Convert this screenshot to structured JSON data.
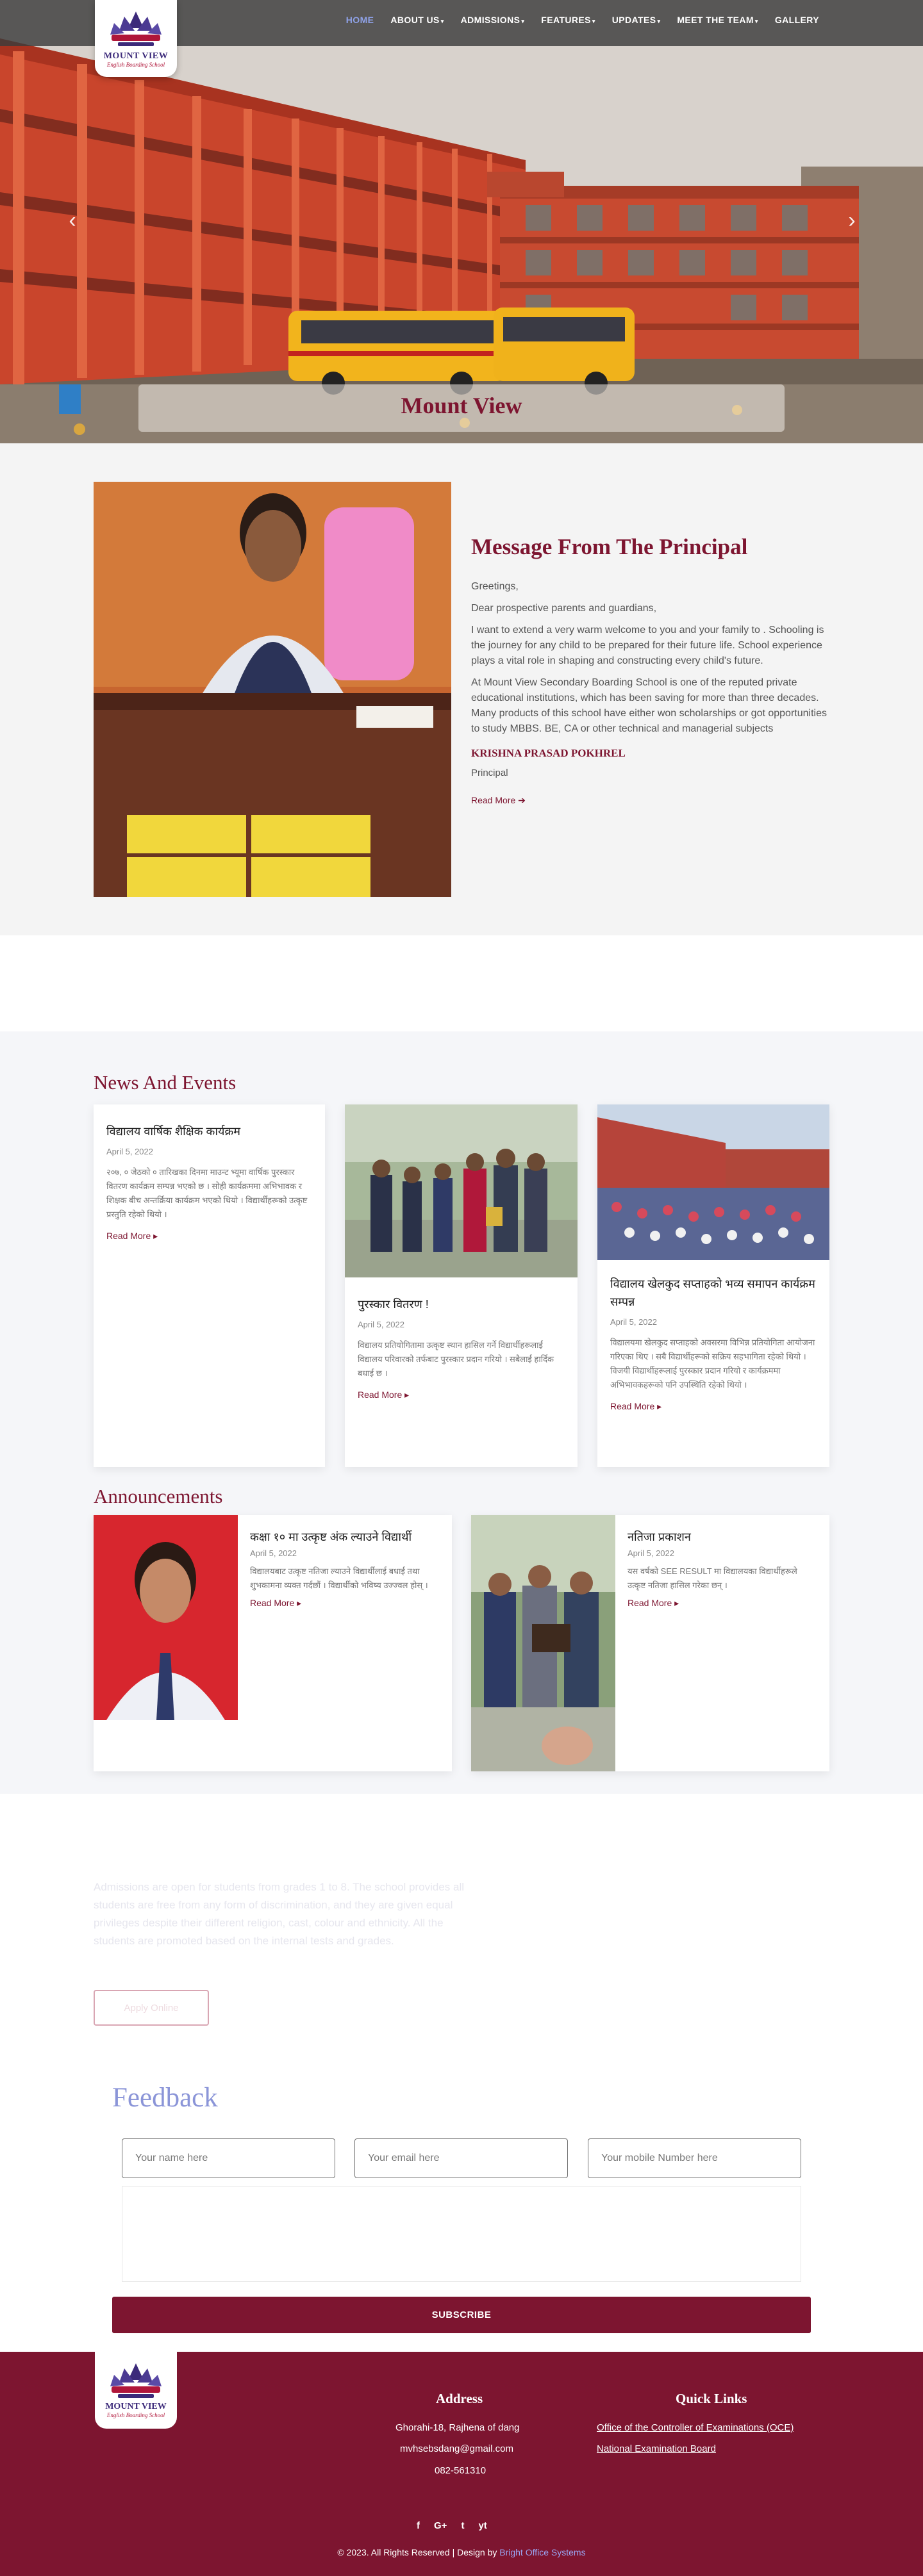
{
  "brand": {
    "logo_line1": "MOUNT VIEW",
    "logo_line2": "English Boarding School"
  },
  "nav": {
    "items": [
      {
        "label": "HOME"
      },
      {
        "label": "ABOUT US"
      },
      {
        "label": "ADMISSIONS"
      },
      {
        "label": "FEATURES"
      },
      {
        "label": "UPDATES"
      },
      {
        "label": "MEET THE TEAM"
      },
      {
        "label": "GALLERY"
      }
    ],
    "active": "HOME"
  },
  "hero": {
    "title": "Mount View",
    "prev_icon": "‹",
    "next_icon": "›"
  },
  "principal": {
    "title": "Message From The Principal",
    "greeting": "Greetings,",
    "salutation": "Dear prospective parents and guardians,",
    "para1": "I want to extend a very warm welcome to you and your family to . Schooling is the journey for any child to be prepared for their future life. School experience plays a vital role in shaping and constructing every child's future.",
    "para2": "At Mount View Secondary Boarding School is one of the reputed private educational institutions, which has been saving for more than three decades. Many products of this school have either won scholarships or got opportunities to study MBBS. BE, CA or other technical and managerial subjects",
    "name": "KRISHNA PRASAD POKHREL",
    "role": "Principal",
    "read_more": "Read More"
  },
  "news": {
    "title": "News And Events",
    "items": [
      {
        "title": "विद्यालय वार्षिक शैक्षिक कार्यक्रम",
        "date": "April 5, 2022",
        "excerpt": "२०७, ० जेठको ० तारिखका दिनमा माउन्ट भ्यूमा वार्षिक पुरस्कार वितरण कार्यक्रम सम्पन्न भएको छ । सोही कार्यक्रममा अभिभावक र शिक्षक बीच अन्तर्क्रिया कार्यक्रम भएको थियो । विद्यार्थीहरूको उत्कृष्ट प्रस्तुति रहेको थियो ।",
        "read_more": "Read More"
      },
      {
        "title": "पुरस्कार वितरण !",
        "date": "April 5, 2022",
        "excerpt": "विद्यालय प्रतियोगितामा उत्कृष्ट स्थान हासिल गर्ने विद्यार्थीहरूलाई विद्यालय परिवारको तर्फबाट पुरस्कार प्रदान गरियो । सबैलाई हार्दिक बधाई छ ।",
        "read_more": "Read More"
      },
      {
        "title": "विद्यालय खेलकुद सप्ताहको भव्य समापन कार्यक्रम सम्पन्न",
        "date": "April 5, 2022",
        "excerpt": "विद्यालयमा खेलकुद सप्ताहको अवसरमा विभिन्न प्रतियोगिता आयोजना गरिएका थिए । सबै विद्यार्थीहरूको सक्रिय सहभागिता रहेको थियो । विजयी विद्यार्थीहरूलाई पुरस्कार प्रदान गरियो र कार्यक्रममा अभिभावकहरूको पनि उपस्थिति रहेको थियो ।",
        "read_more": "Read More"
      }
    ]
  },
  "announcements": {
    "title": "Announcements",
    "items": [
      {
        "title": "कक्षा १० मा उत्कृष्ट अंक ल्याउने विद्यार्थी",
        "date": "April 5, 2022",
        "excerpt": "विद्यालयबाट उत्कृष्ट नतिजा ल्याउने विद्यार्थीलाई बधाई तथा शुभकामना व्यक्त गर्दछौं । विद्यार्थीको भविष्य उज्ज्वल होस् ।",
        "read_more": "Read More"
      },
      {
        "title": "नतिजा प्रकाशन",
        "date": "April 5, 2022",
        "excerpt": "यस वर्षको SEE RESULT मा विद्यालयका विद्यार्थीहरूले उत्कृष्ट नतिजा हासिल गरेका छन् ।",
        "read_more": "Read More"
      }
    ]
  },
  "cta": {
    "text": "Admissions are open for students from grades 1 to 8. The school provides all students are free from any form of discrimination, and they are given equal privileges despite their different religion, cast, colour and ethnicity. All the students are promoted based on the internal tests and grades.",
    "button": "Apply Online"
  },
  "feedback": {
    "title": "Feedback",
    "name_placeholder": "Your name here",
    "email_placeholder": "Your email here",
    "mobile_placeholder": "Your mobile Number here",
    "submit": "SUBSCRIBE"
  },
  "footer": {
    "address_title": "Address",
    "address": "Ghorahi-18, Rajhena of dang",
    "email": "mvhsebsdang@gmail.com",
    "phone": "082-561310",
    "links_title": "Quick Links",
    "links": [
      {
        "label": "Office of the Controller of Examinations (OCE)"
      },
      {
        "label": "National Examination Board"
      }
    ],
    "socials": [
      "f",
      "G+",
      "t",
      "yt"
    ],
    "copyright": "© 2023. All Rights Reserved | Design by",
    "designer": "Bright Office Systems"
  },
  "colors": {
    "primary": "#7d1530",
    "nav_active": "#8fa2e8",
    "feedback_title": "#8b95d8"
  },
  "icons": {
    "read_more": "arrow-right-icon",
    "socials": [
      "facebook-icon",
      "google-plus-icon",
      "twitter-icon",
      "youtube-icon"
    ]
  }
}
